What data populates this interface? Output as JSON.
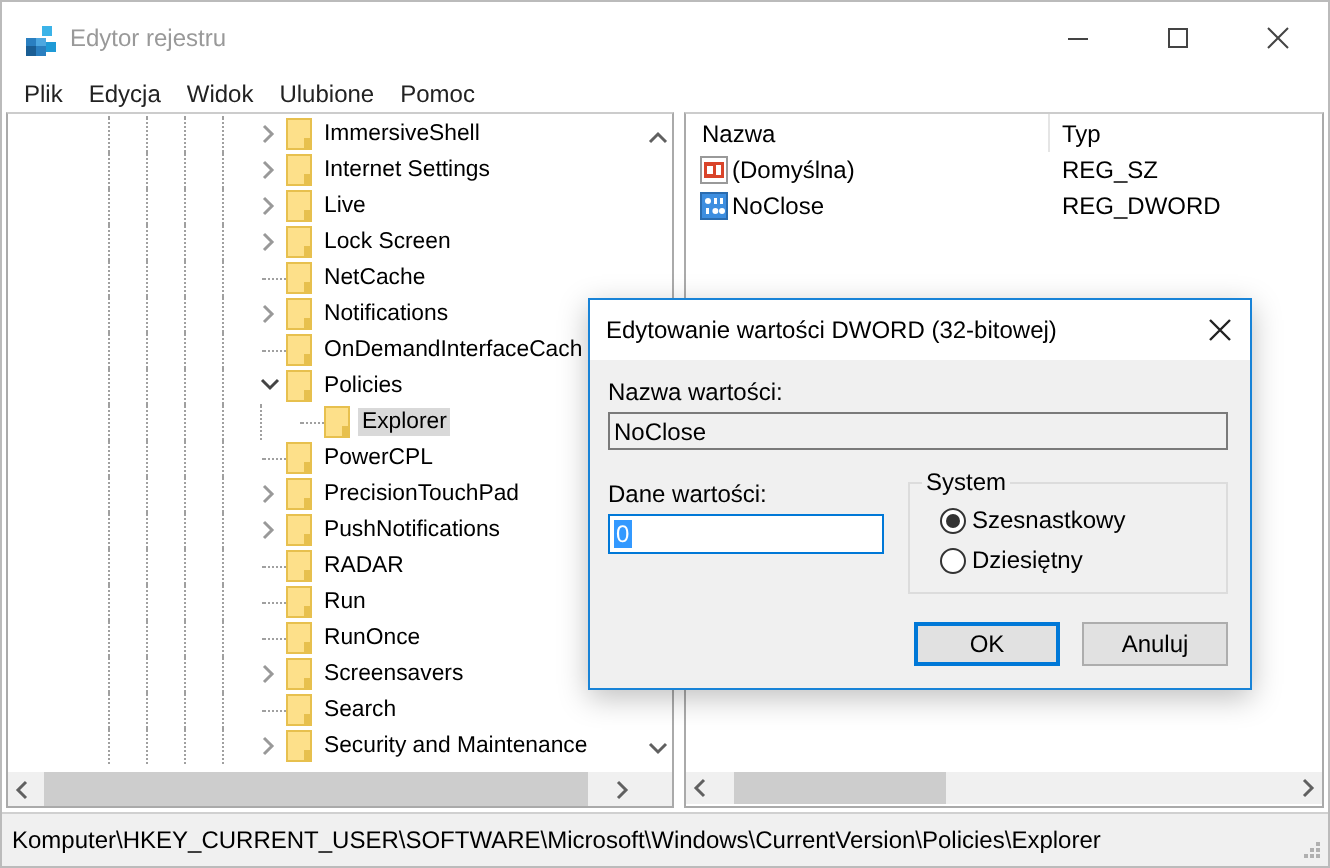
{
  "window": {
    "title": "Edytor rejestru"
  },
  "menu": [
    "Plik",
    "Edycja",
    "Widok",
    "Ulubione",
    "Pomoc"
  ],
  "tree": {
    "items": [
      {
        "label": "ImmersiveShell",
        "expanded": false,
        "selected": false
      },
      {
        "label": "Internet Settings",
        "expanded": false,
        "selected": false
      },
      {
        "label": "Live",
        "expanded": false,
        "selected": false
      },
      {
        "label": "Lock Screen",
        "expanded": false,
        "selected": false
      },
      {
        "label": "NetCache",
        "selected": false
      },
      {
        "label": "Notifications",
        "expanded": false,
        "selected": false
      },
      {
        "label": "OnDemandInterfaceCach",
        "selected": false
      },
      {
        "label": "Policies",
        "expanded": true,
        "selected": false,
        "children": [
          {
            "label": "Explorer",
            "selected": true
          }
        ]
      },
      {
        "label": "PowerCPL",
        "selected": false
      },
      {
        "label": "PrecisionTouchPad",
        "expanded": false,
        "selected": false
      },
      {
        "label": "PushNotifications",
        "expanded": false,
        "selected": false
      },
      {
        "label": "RADAR",
        "selected": false
      },
      {
        "label": "Run",
        "selected": false
      },
      {
        "label": "RunOnce",
        "selected": false
      },
      {
        "label": "Screensavers",
        "expanded": false,
        "selected": false
      },
      {
        "label": "Search",
        "selected": false
      },
      {
        "label": "Security and Maintenance",
        "expanded": false,
        "selected": false
      }
    ]
  },
  "values": {
    "columns": [
      "Nazwa",
      "Typ"
    ],
    "rows": [
      {
        "name": "(Domyślna)",
        "type": "REG_SZ",
        "kind": "string"
      },
      {
        "name": "NoClose",
        "type": "REG_DWORD",
        "kind": "dword"
      }
    ]
  },
  "dialog": {
    "title": "Edytowanie wartości DWORD (32-bitowej)",
    "name_label": "Nazwa wartości:",
    "name_value": "NoClose",
    "data_label": "Dane wartości:",
    "data_value": "0",
    "base_title": "System",
    "bases": [
      {
        "label": "Szesnastkowy",
        "selected": true
      },
      {
        "label": "Dziesiętny",
        "selected": false
      }
    ],
    "buttons": [
      {
        "label": "OK",
        "default": true
      },
      {
        "label": "Anuluj",
        "default": false
      }
    ]
  },
  "status_bar": "Komputer\\HKEY_CURRENT_USER\\SOFTWARE\\Microsoft\\Windows\\CurrentVersion\\Policies\\Explorer"
}
